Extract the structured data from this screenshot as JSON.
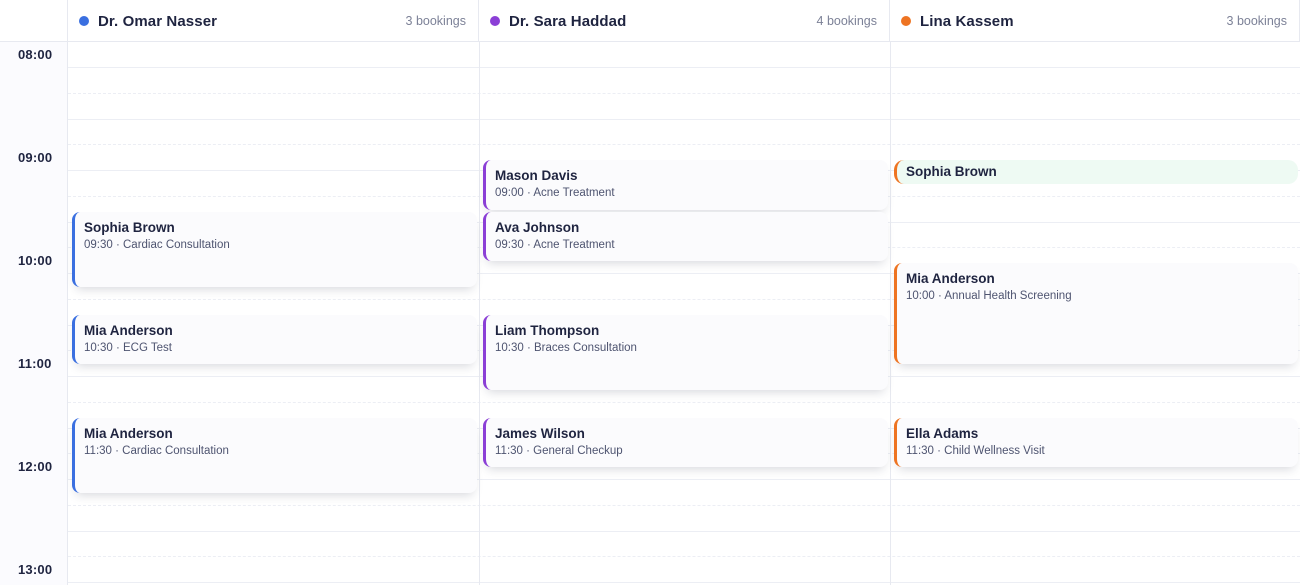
{
  "columns": [
    {
      "name": "Dr. Omar Nasser",
      "count": "3 bookings",
      "color": "#3a6fe0"
    },
    {
      "name": "Dr. Sara Haddad",
      "count": "4 bookings",
      "color": "#8b3fd6"
    },
    {
      "name": "Lina Kassem",
      "count": "3 bookings",
      "color": "#ee7422"
    }
  ],
  "times": [
    "08:00",
    "09:00",
    "10:00",
    "11:00",
    "12:00",
    "13:00"
  ],
  "events": [
    {
      "column": 0,
      "start": "09:30",
      "duration": 45,
      "name": "Sophia Brown",
      "meta": "09:30 · Cardiac Consultation"
    },
    {
      "column": 0,
      "start": "10:30",
      "duration": 30,
      "name": "Mia Anderson",
      "meta": "10:30 · ECG Test"
    },
    {
      "column": 0,
      "start": "11:30",
      "duration": 45,
      "name": "Mia Anderson",
      "meta": "11:30 · Cardiac Consultation"
    },
    {
      "column": 1,
      "start": "09:00",
      "duration": 30,
      "name": "Mason Davis",
      "meta": "09:00 · Acne Treatment"
    },
    {
      "column": 1,
      "start": "09:30",
      "duration": 30,
      "name": "Ava Johnson",
      "meta": "09:30 · Acne Treatment"
    },
    {
      "column": 1,
      "start": "10:30",
      "duration": 45,
      "name": "Liam Thompson",
      "meta": "10:30 · Braces Consultation"
    },
    {
      "column": 1,
      "start": "11:30",
      "duration": 30,
      "name": "James Wilson",
      "meta": "11:30 · General Checkup"
    },
    {
      "column": 2,
      "start": "09:00",
      "duration": 15,
      "name": "Sophia Brown",
      "meta": "",
      "compact": true
    },
    {
      "column": 2,
      "start": "10:00",
      "duration": 60,
      "name": "Mia Anderson",
      "meta": "10:00 · Annual Health Screening"
    },
    {
      "column": 2,
      "start": "11:30",
      "duration": 30,
      "name": "Ella Adams",
      "meta": "11:30 · Child Wellness Visit"
    }
  ]
}
